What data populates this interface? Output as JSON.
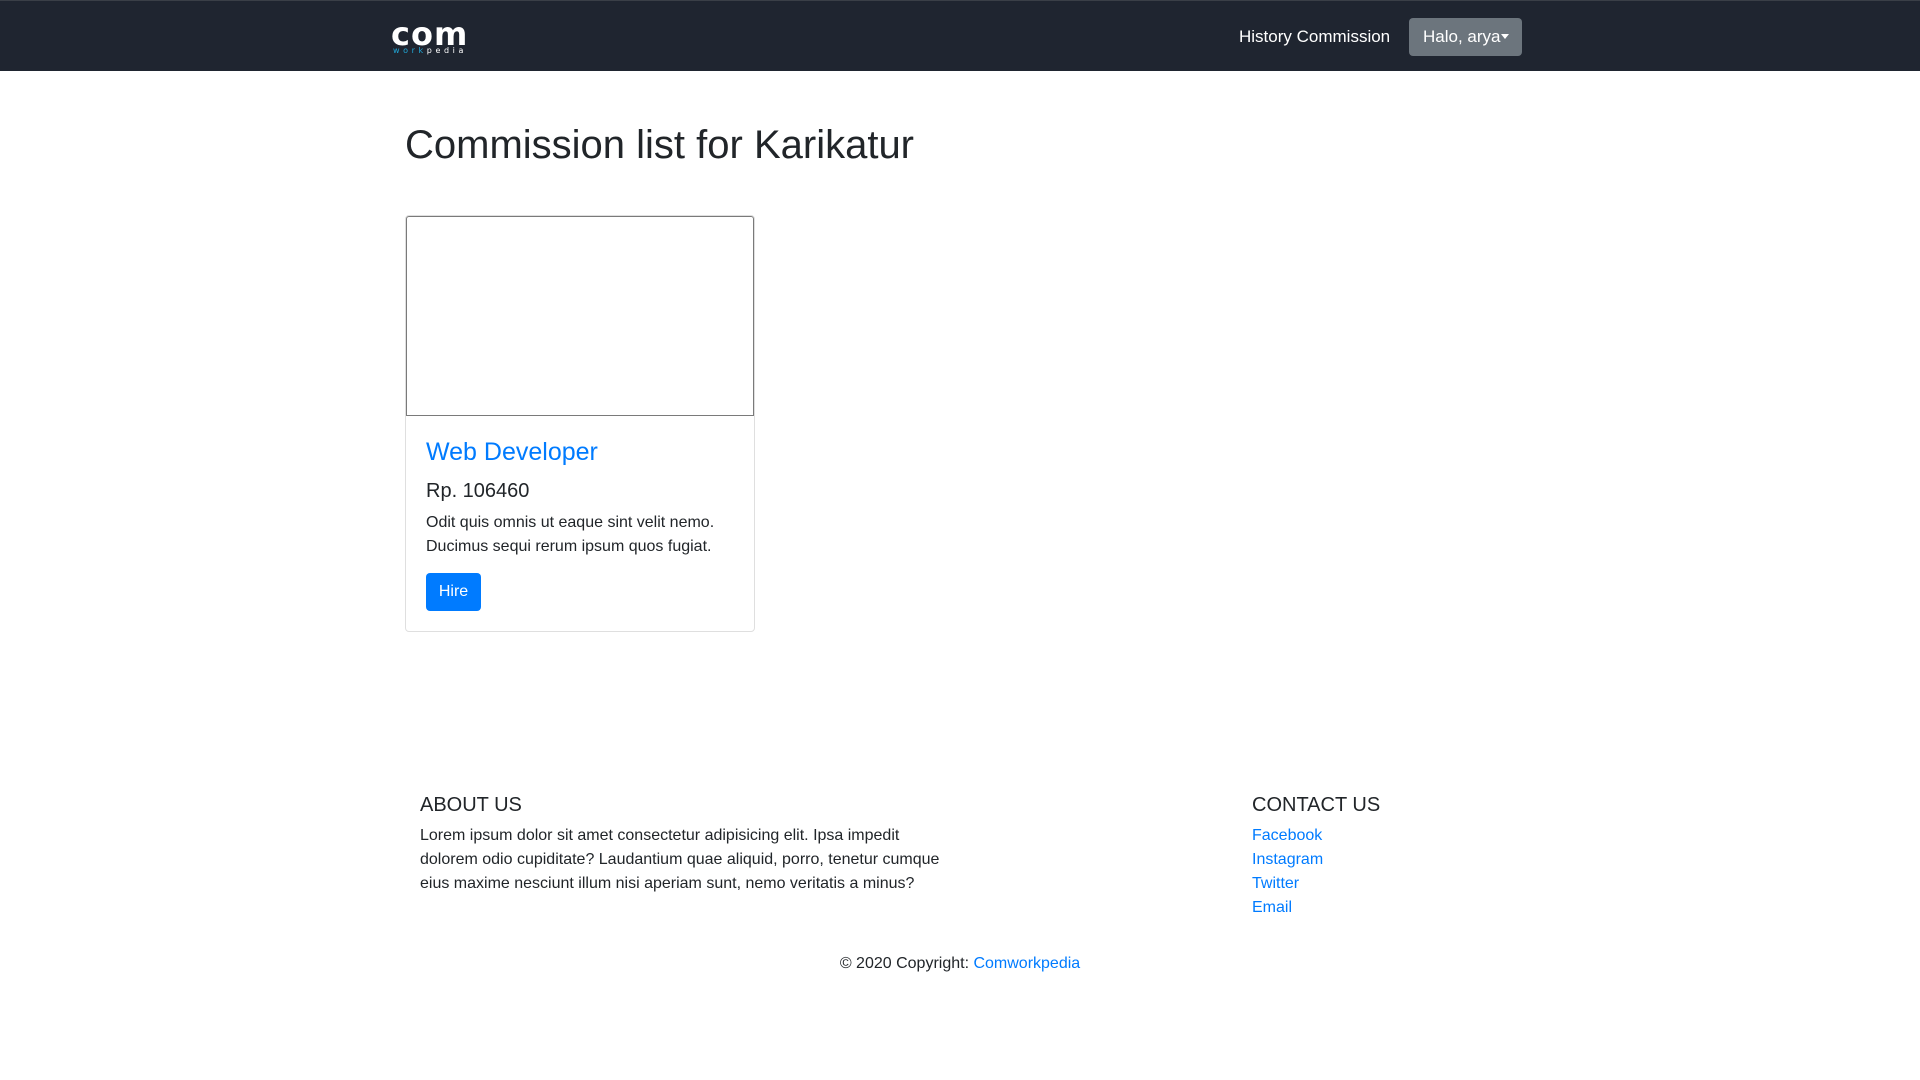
{
  "navbar": {
    "brand_main": "com",
    "brand_sub_work": "work",
    "brand_sub_pedia": "pedia",
    "history_link": "History Commission",
    "user_menu": "Halo, arya",
    "background": "#1f2530"
  },
  "main": {
    "title": "Commission list for Karikatur",
    "cards": [
      {
        "title": "Web Developer",
        "price": "Rp. 106460",
        "description": "Odit quis omnis ut eaque sint velit nemo. Ducimus sequi rerum ipsum quos fugiat.",
        "button": "Hire"
      }
    ]
  },
  "footer": {
    "about_heading": "ABOUT US",
    "about_text": "Lorem ipsum dolor sit amet consectetur adipisicing elit. Ipsa impedit dolorem odio cupiditate? Laudantium quae aliquid, porro, tenetur cumque eius maxime nesciunt illum nisi aperiam sunt, nemo veritatis a minus?",
    "contact_heading": "CONTACT US",
    "contact_links": [
      "Facebook",
      "Instagram",
      "Twitter",
      "Email"
    ],
    "copyright_text": "© 2020 Copyright:",
    "copyright_link": "Comworkpedia"
  },
  "colors": {
    "accent": "#007bff",
    "secondary_button": "#6c757d"
  }
}
